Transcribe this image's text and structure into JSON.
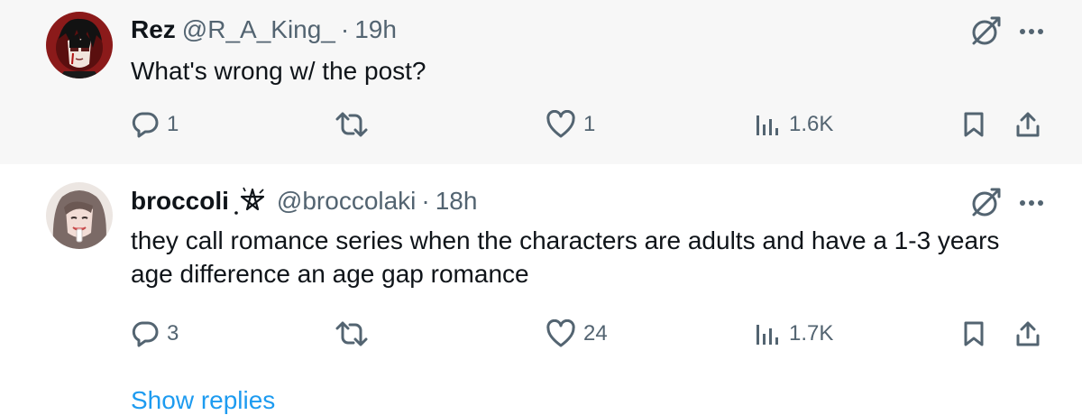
{
  "tweets": [
    {
      "name": "Rez",
      "handle": "@R_A_King_",
      "dot": "·",
      "time": "19h",
      "text": "What's wrong w/ the post?",
      "replies": "1",
      "retweets": "",
      "likes": "1",
      "views": "1.6K"
    },
    {
      "name": "broccoli",
      "handle": "@broccolaki",
      "dot": "·",
      "time": "18h",
      "text": "they call romance series when the characters are adults and have a 1-3 years age difference an age gap romance",
      "replies": "3",
      "retweets": "",
      "likes": "24",
      "views": "1.7K"
    }
  ],
  "show_replies": "Show replies",
  "icons": {
    "grok": "grok-icon",
    "more": "more-icon",
    "reply": "reply-icon",
    "retweet": "retweet-icon",
    "like": "like-icon",
    "views": "views-icon",
    "bookmark": "bookmark-icon",
    "share": "share-icon",
    "pentagram": "pentagram-icon"
  },
  "colors": {
    "text": "#0f1419",
    "secondary": "#536471",
    "link": "#1d9bf0",
    "thread_line": "#cfd9de",
    "highlight_bg": "#f7f7f7"
  }
}
